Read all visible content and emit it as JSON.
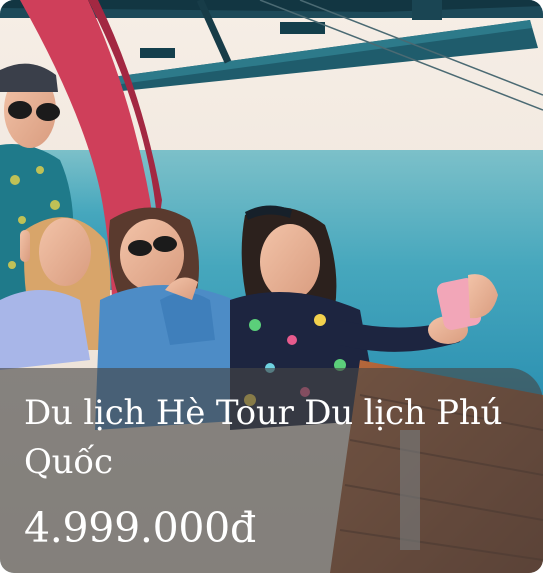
{
  "tour_card": {
    "title": "Du lịch Hè Tour Du lịch Phú Quốc",
    "price": "4.999.000đ",
    "image_alt": "Group of friends taking a selfie inside a cable car above the sea"
  }
}
